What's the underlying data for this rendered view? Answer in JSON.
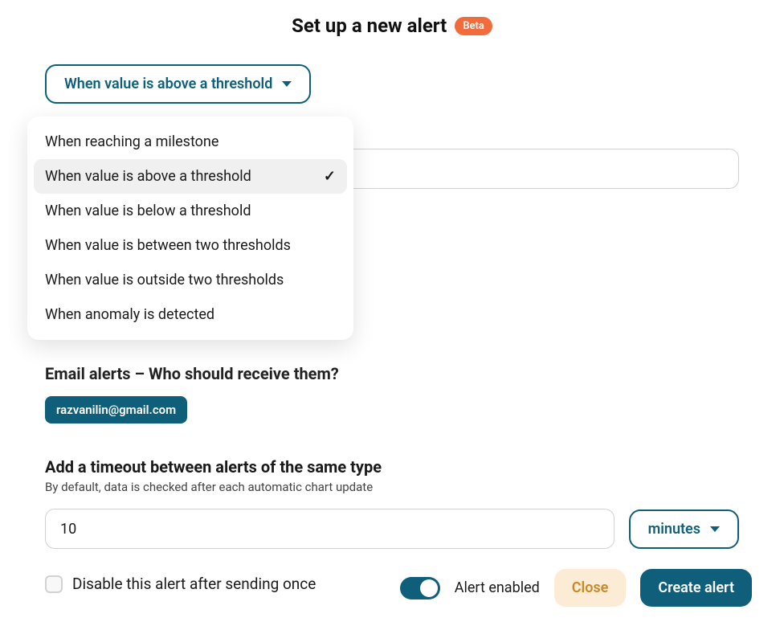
{
  "header": {
    "title": "Set up a new alert",
    "badge": "Beta"
  },
  "trigger": {
    "label": "When value is above a threshold",
    "options": [
      {
        "label": "When reaching a milestone",
        "selected": false
      },
      {
        "label": "When value is above a threshold",
        "selected": true
      },
      {
        "label": "When value is below a threshold",
        "selected": false
      },
      {
        "label": "When value is between two thresholds",
        "selected": false
      },
      {
        "label": "When value is outside two thresholds",
        "selected": false
      },
      {
        "label": "When anomaly is detected",
        "selected": false
      }
    ]
  },
  "email": {
    "section_header": "Email alerts – Who should receive them?",
    "recipients": [
      "razvanilin@gmail.com"
    ]
  },
  "timeout": {
    "title": "Add a timeout between alerts of the same type",
    "subtitle": "By default, data is checked after each automatic chart update",
    "value": "10",
    "unit": "minutes"
  },
  "disable_once": {
    "label": "Disable this alert after sending once",
    "checked": false
  },
  "footer": {
    "toggle_label": "Alert enabled",
    "toggle_on": true,
    "close_label": "Close",
    "create_label": "Create alert"
  }
}
